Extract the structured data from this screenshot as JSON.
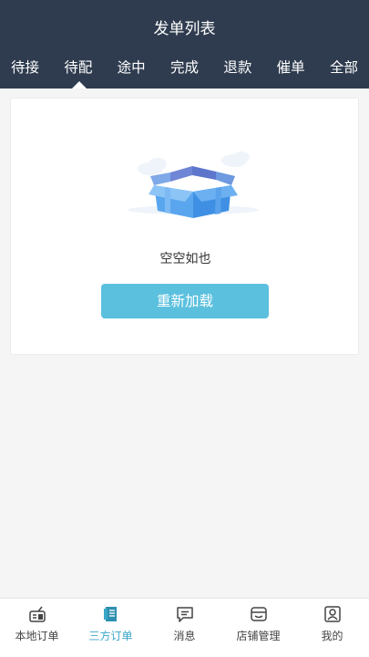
{
  "header": {
    "title": "发单列表",
    "tabs": [
      "待接",
      "待配",
      "途中",
      "完成",
      "退款",
      "催单",
      "全部"
    ],
    "active_tab": "待配"
  },
  "empty_state": {
    "message": "空空如也",
    "reload_label": "重新加载",
    "icon": "empty-box-illustration"
  },
  "bottom_nav": {
    "items": [
      {
        "label": "本地订单",
        "icon": "local-order-icon"
      },
      {
        "label": "三方订单",
        "icon": "third-party-order-icon"
      },
      {
        "label": "消息",
        "icon": "message-icon"
      },
      {
        "label": "店铺管理",
        "icon": "store-manage-icon"
      },
      {
        "label": "我的",
        "icon": "profile-icon"
      }
    ],
    "active": "三方订单"
  },
  "colors": {
    "header_bg": "#2f3c4f",
    "accent": "#5bc0de",
    "active_nav": "#3aa6c8"
  }
}
